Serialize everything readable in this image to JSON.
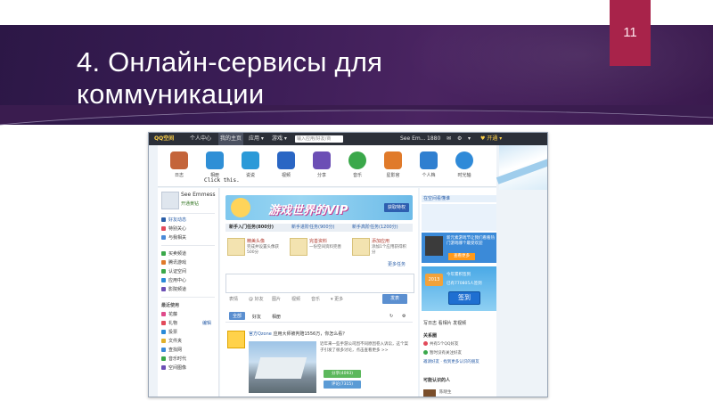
{
  "slide": {
    "title": "4. Онлайн-сервисы для коммуникации",
    "page_number": "11"
  },
  "qzone": {
    "topbar": {
      "logo": "QQ空间",
      "items": [
        "个人中心",
        "我的主页",
        "应用 ▾",
        "游戏 ▾"
      ],
      "search_placeholder": "输入应用/好友/商",
      "right_items": [
        "See Em...",
        "1880",
        "✉",
        "⚙",
        "▾",
        "♥ 开通 ▾"
      ]
    },
    "apps": [
      {
        "label": "日志",
        "color": "#c4643a"
      },
      {
        "label": "相册",
        "color": "#2f8fd6"
      },
      {
        "label": "说说",
        "color": "#2b9ad8"
      },
      {
        "label": "视频",
        "color": "#2a66c4"
      },
      {
        "label": "分享",
        "color": "#6c4fb5"
      },
      {
        "label": "音乐",
        "color": "#3aa84a"
      },
      {
        "label": "星影官",
        "color": "#e07a2a"
      },
      {
        "label": "个人档",
        "color": "#2f7fd0"
      },
      {
        "label": "时光轴",
        "color": "#2f8ad8"
      }
    ],
    "click_hint": "Click this.",
    "sidebar": {
      "user_name": "See Emmess",
      "badge": "开通黄钻",
      "items": [
        "好友动态",
        "特别关心",
        "与我相关"
      ],
      "items2": [
        "买卖频道",
        "腾讯游戏",
        "认证空间",
        "应用中心",
        "影院频道"
      ],
      "section": "最近使用",
      "recent": [
        "花藤",
        "礼物",
        "投票",
        "文件夹",
        "查找网",
        "音乐时代",
        "空间图像"
      ],
      "manage": "编辑"
    },
    "vip": {
      "text": "游戏世界的VIP",
      "button": "获取特权"
    },
    "task_tabs": [
      "新手入门任务(800分)",
      "新手进阶任务(900分)",
      "新手高阶任务(1200分)"
    ],
    "tasks": [
      {
        "title": "精美头像",
        "desc": "完成并设置头像获500分"
      },
      {
        "title": "完善资料",
        "desc": "一份空间资料完善"
      },
      {
        "title": "添加应用",
        "desc": "添加1个应用获得积分"
      }
    ],
    "more_tasks": "更多任务",
    "composer_tools": [
      "表情",
      "@ 好友",
      "图片",
      "视频",
      "音乐",
      "▾ 更多"
    ],
    "publish": "发表",
    "feed_tabs": [
      "全部",
      "好友",
      "相册"
    ],
    "post": {
      "author": "官方Qzone",
      "text": "应用大师被判赔1556万，你怎么看？",
      "desc": "近年来一些手游公司因不同原因卷入诉讼，这个案子引发了很多讨论，点击查看更多 >>",
      "btn1": "分享(4093)",
      "btn2": "评论(7315)"
    },
    "right": {
      "head": "在空间看懂谁",
      "ad_text": "新元素游戏节让我们看看热门游戏哪个最受欢迎",
      "ad_button": "查看更多",
      "year": "2013",
      "points_line1": "今年累积签到",
      "points_line2": "已有770805人签到",
      "sign": "签到",
      "tools": "写日志   看相片   发视频",
      "friends_head": "关系圈",
      "friends": [
        "共有5个QQ好友",
        "暂时没有关注好友"
      ],
      "friends_more": "邀请好友 · 找到更多认识的朋友",
      "known_head": "可能认识的人",
      "known": [
        "陈晓生"
      ]
    }
  }
}
